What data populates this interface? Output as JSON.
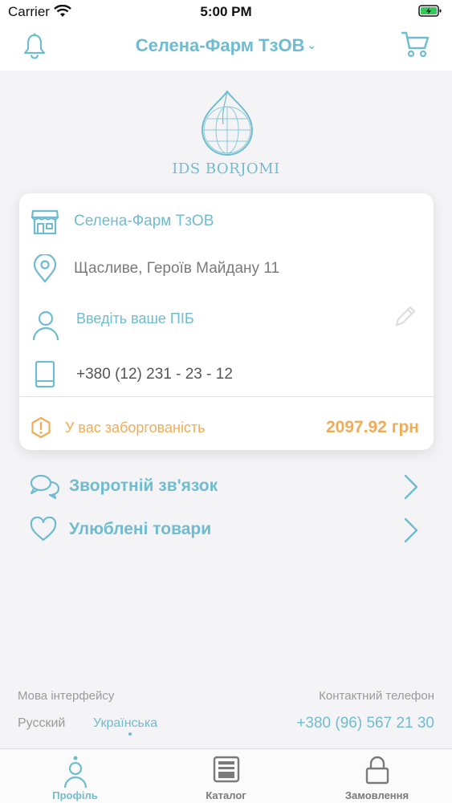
{
  "status_bar": {
    "carrier": "Carrier",
    "time": "5:00 PM"
  },
  "nav": {
    "title": "Селена-Фарм ТзОВ",
    "chevron": "⌄"
  },
  "logo": {
    "text": "IDS BORJOMI"
  },
  "card": {
    "store_name": "Селена-Фарм ТзОВ",
    "address": "Щасливе, Героїв Майдану  11",
    "name_placeholder": "Введіть ваше ПІБ",
    "phone": "+380 (12) 231 - 23 - 12",
    "debt_label": "У вас заборгованість",
    "debt_amount": "2097.92 грн"
  },
  "menu": {
    "feedback": "Зворотній зв'язок",
    "favorites": "Улюблені товари"
  },
  "footer": {
    "language_title": "Мова інтерфейсу",
    "language_ru": "Русский",
    "language_ua": "Українська",
    "phone_title": "Контактний телефон",
    "phone_value": "+380 (96) 567 21 30"
  },
  "tabs": [
    {
      "label": "Профіль",
      "icon": "person-icon",
      "active": true
    },
    {
      "label": "Каталог",
      "icon": "catalog-icon",
      "active": false
    },
    {
      "label": "Замовлення",
      "icon": "lock-icon",
      "active": false
    }
  ],
  "colors": {
    "accent": "#6fbcd0",
    "warning": "#f0ad56",
    "muted": "#9a9a9a"
  }
}
